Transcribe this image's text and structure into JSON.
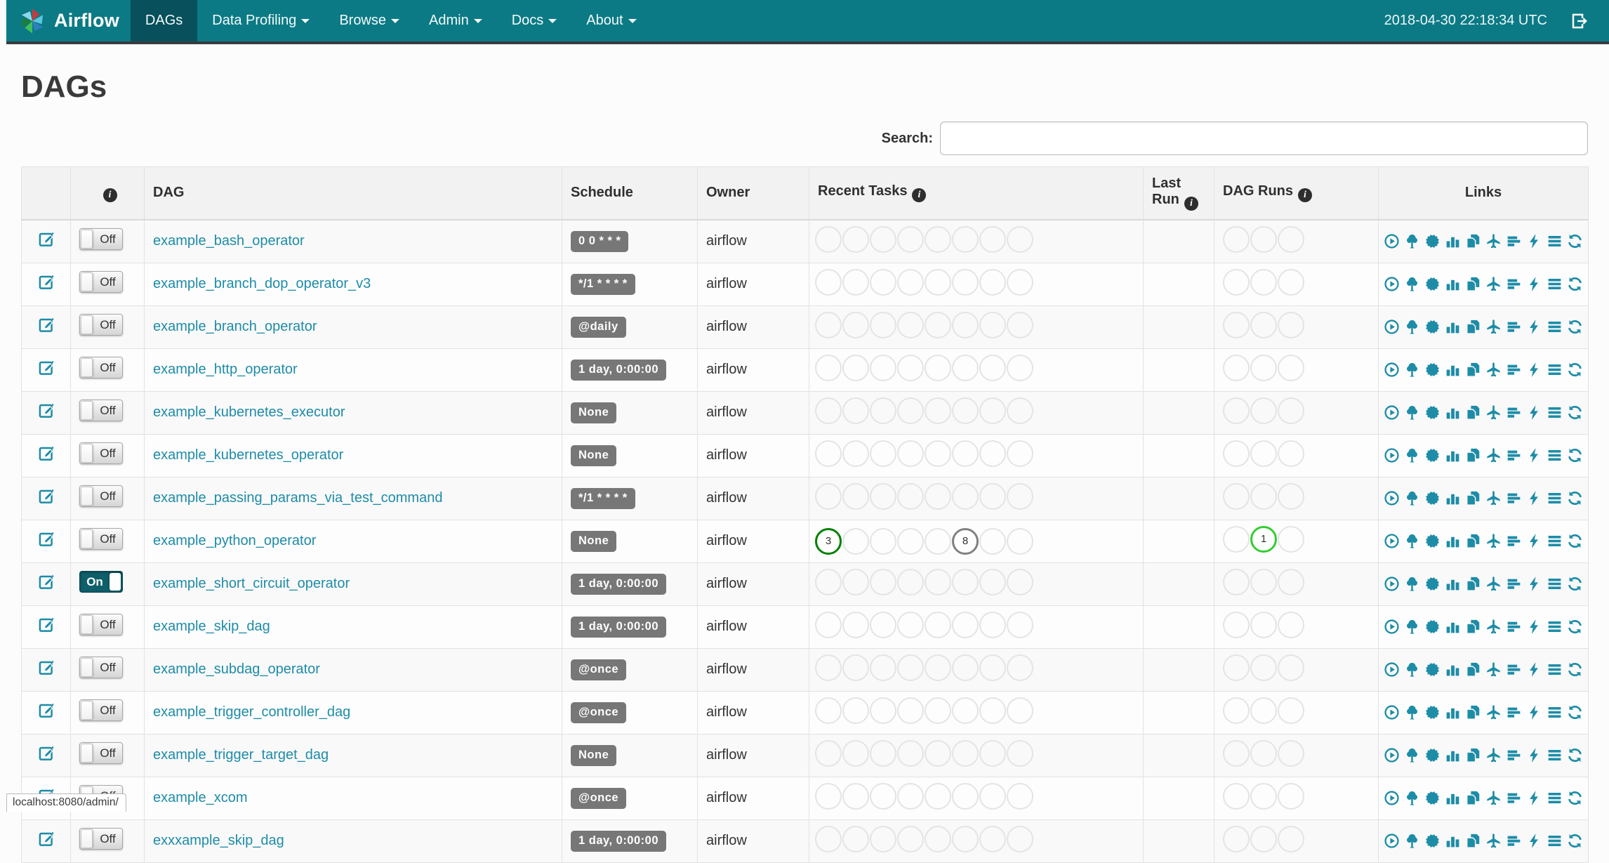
{
  "navbar": {
    "brand": "Airflow",
    "items": [
      {
        "label": "DAGs",
        "active": true,
        "dropdown": false
      },
      {
        "label": "Data Profiling",
        "active": false,
        "dropdown": true
      },
      {
        "label": "Browse",
        "active": false,
        "dropdown": true
      },
      {
        "label": "Admin",
        "active": false,
        "dropdown": true
      },
      {
        "label": "Docs",
        "active": false,
        "dropdown": true
      },
      {
        "label": "About",
        "active": false,
        "dropdown": true
      }
    ],
    "clock": "2018-04-30 22:18:34 UTC",
    "colors": {
      "background": "#0b7a85",
      "active_item": "#07505c",
      "text": "#ffffff"
    }
  },
  "page": {
    "title": "DAGs",
    "search_label": "Search:",
    "search_value": "",
    "status_bar": "localhost:8080/admin/"
  },
  "table": {
    "headers": {
      "dag": "DAG",
      "schedule": "Schedule",
      "owner": "Owner",
      "recent_tasks": "Recent Tasks",
      "last_run": "Last Run",
      "dag_runs": "DAG Runs",
      "links": "Links"
    },
    "recent_task_slots": 8,
    "dag_run_slots": 3,
    "link_icons": [
      "trigger-dag",
      "tree-view",
      "graph-view",
      "task-duration",
      "task-tries",
      "landing-times",
      "gantt-view",
      "code-view",
      "logs",
      "refresh"
    ],
    "rows": [
      {
        "dag": "example_bash_operator",
        "enabled": "Off",
        "schedule": "0 0 * * *",
        "owner": "airflow",
        "recent_tasks": [],
        "dag_runs": []
      },
      {
        "dag": "example_branch_dop_operator_v3",
        "enabled": "Off",
        "schedule": "*/1 * * * *",
        "owner": "airflow",
        "recent_tasks": [],
        "dag_runs": []
      },
      {
        "dag": "example_branch_operator",
        "enabled": "Off",
        "schedule": "@daily",
        "owner": "airflow",
        "recent_tasks": [],
        "dag_runs": []
      },
      {
        "dag": "example_http_operator",
        "enabled": "Off",
        "schedule": "1 day, 0:00:00",
        "owner": "airflow",
        "recent_tasks": [],
        "dag_runs": []
      },
      {
        "dag": "example_kubernetes_executor",
        "enabled": "Off",
        "schedule": "None",
        "owner": "airflow",
        "recent_tasks": [],
        "dag_runs": []
      },
      {
        "dag": "example_kubernetes_operator",
        "enabled": "Off",
        "schedule": "None",
        "owner": "airflow",
        "recent_tasks": [],
        "dag_runs": []
      },
      {
        "dag": "example_passing_params_via_test_command",
        "enabled": "Off",
        "schedule": "*/1 * * * *",
        "owner": "airflow",
        "recent_tasks": [],
        "dag_runs": []
      },
      {
        "dag": "example_python_operator",
        "enabled": "Off",
        "schedule": "None",
        "owner": "airflow",
        "recent_tasks": [
          {
            "index": 0,
            "value": 3,
            "state": "success",
            "color": "#008000"
          },
          {
            "index": 5,
            "value": 8,
            "state": "queued",
            "color": "#808080"
          }
        ],
        "dag_runs": [
          {
            "index": 1,
            "value": 1,
            "state": "running",
            "color": "#32cd32"
          }
        ]
      },
      {
        "dag": "example_short_circuit_operator",
        "enabled": "On",
        "schedule": "1 day, 0:00:00",
        "owner": "airflow",
        "recent_tasks": [],
        "dag_runs": []
      },
      {
        "dag": "example_skip_dag",
        "enabled": "Off",
        "schedule": "1 day, 0:00:00",
        "owner": "airflow",
        "recent_tasks": [],
        "dag_runs": []
      },
      {
        "dag": "example_subdag_operator",
        "enabled": "Off",
        "schedule": "@once",
        "owner": "airflow",
        "recent_tasks": [],
        "dag_runs": []
      },
      {
        "dag": "example_trigger_controller_dag",
        "enabled": "Off",
        "schedule": "@once",
        "owner": "airflow",
        "recent_tasks": [],
        "dag_runs": []
      },
      {
        "dag": "example_trigger_target_dag",
        "enabled": "Off",
        "schedule": "None",
        "owner": "airflow",
        "recent_tasks": [],
        "dag_runs": []
      },
      {
        "dag": "example_xcom",
        "enabled": "Off",
        "schedule": "@once",
        "owner": "airflow",
        "recent_tasks": [],
        "dag_runs": []
      },
      {
        "dag": "exxxample_skip_dag",
        "enabled": "Off",
        "schedule": "1 day, 0:00:00",
        "owner": "airflow",
        "recent_tasks": [],
        "dag_runs": []
      }
    ],
    "colors": {
      "accent_teal": "#1d8ca7",
      "badge_background": "#777777",
      "circle_empty_border": "#e4e4e4",
      "state_success": "#008000",
      "state_running": "#32cd32",
      "state_queued": "#808080",
      "toggle_on_background": "#0f5f6b"
    }
  }
}
